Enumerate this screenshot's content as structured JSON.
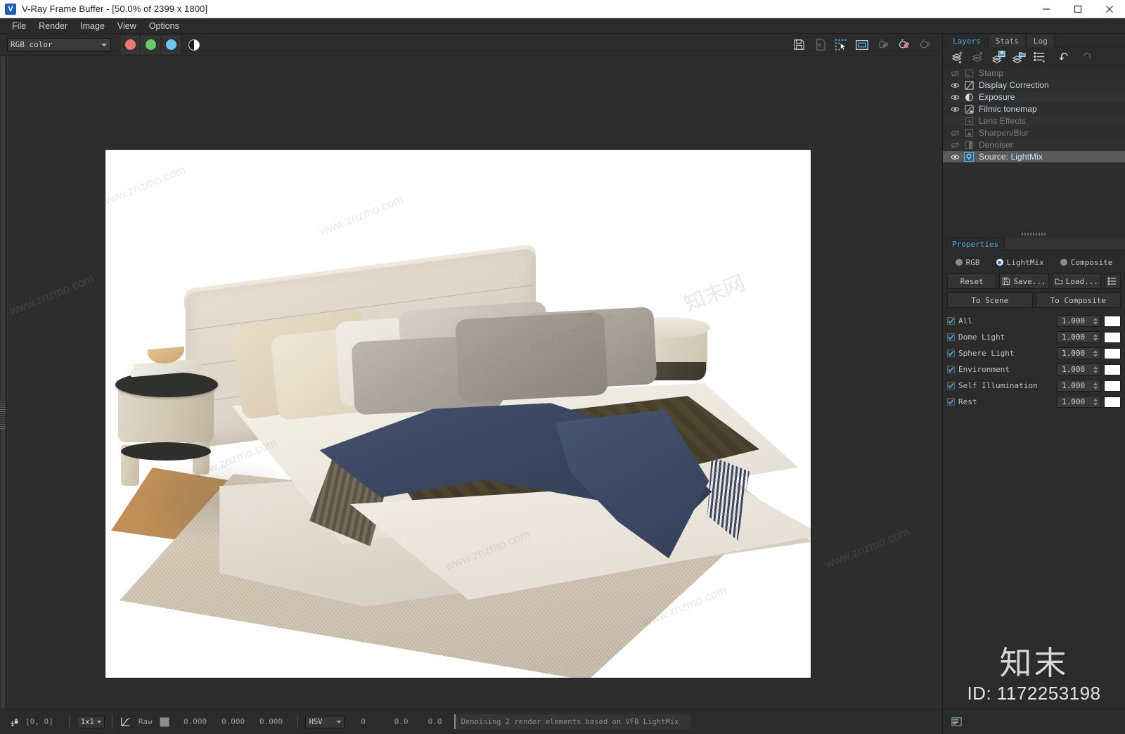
{
  "window": {
    "title": "V-Ray Frame Buffer - [50.0% of 2399 x 1800]",
    "icon": "vray-logo-icon",
    "minimize": "—",
    "maximize": "☐",
    "close": "✕"
  },
  "menubar": {
    "items": [
      {
        "label": "File"
      },
      {
        "label": "Render"
      },
      {
        "label": "Image"
      },
      {
        "label": "View"
      },
      {
        "label": "Options"
      }
    ]
  },
  "toolbar": {
    "channel_select": {
      "value": "RGB color",
      "icon": "chevron-down-icon"
    },
    "channels": [
      {
        "name": "red-channel-button",
        "color": "#eb7b78"
      },
      {
        "name": "green-channel-button",
        "color": "#6bcc6b"
      },
      {
        "name": "blue-channel-button",
        "color": "#6fc8ef"
      }
    ],
    "alpha_button": "alpha-channel-icon",
    "right_icons": [
      "save-image-icon",
      "save-all-channels-icon",
      "region-render-icon",
      "show-vfb-icon",
      "render-last-icon",
      "render-icon",
      "render-stop-icon"
    ]
  },
  "image": {
    "zoom_label": "50.0%",
    "resolution": "2399 x 1800",
    "scene_description": "Interior render of an upholstered platform bed with pillows, a grey-green checked runner, a navy blue throw, two round nightstands and a beige area rug on a white background",
    "watermarks": [
      "www.znzmo.com",
      "www.znzmo.com",
      "www.znzmo.com",
      "www.znzmo.com",
      "www.znzmo.com",
      "www.znzmo.com",
      "知末网"
    ]
  },
  "statusbar": {
    "pin_icon": "pixel-lock-icon",
    "coords": "[0,  0]",
    "sample_size": "1x1",
    "curve_icon": "color-curve-icon",
    "raw_label": "Raw",
    "color_swatch": "#8d8d8d",
    "values": [
      "0.000",
      "0.000",
      "0.000"
    ],
    "color_mode": "HSV",
    "hsv": [
      "0",
      "0.0",
      "0.0"
    ],
    "message": "Denoising 2 render elements based on VFB LightMix",
    "layout_icon": "panel-layout-icon"
  },
  "right_panel": {
    "tabs": [
      {
        "label": "Layers",
        "active": true
      },
      {
        "label": "Stats",
        "active": false
      },
      {
        "label": "Log",
        "active": false
      }
    ],
    "layer_toolbar_icons": [
      "add-layer-icon",
      "delete-layer-icon",
      "save-layer-icon",
      "load-layer-icon",
      "layer-list-icon",
      "undo-icon",
      "redo-icon"
    ],
    "layers": [
      {
        "label": "Stamp",
        "icon": "stamp-icon",
        "visible": false,
        "enabled": false,
        "selected": false
      },
      {
        "label": "Display Correction",
        "icon": "curve-icon",
        "visible": true,
        "enabled": true,
        "selected": false
      },
      {
        "label": "Exposure",
        "icon": "exposure-icon",
        "visible": true,
        "enabled": true,
        "selected": false
      },
      {
        "label": "Filmic tonemap",
        "icon": "filmic-tonemap-icon",
        "visible": true,
        "enabled": true,
        "selected": false
      },
      {
        "label": "Lens Effects",
        "icon": "lens-effects-icon",
        "visible": false,
        "enabled": false,
        "selected": false
      },
      {
        "label": "Sharpen/Blur",
        "icon": "sharpen-blur-icon",
        "visible": false,
        "enabled": false,
        "selected": false
      },
      {
        "label": "Denoiser",
        "icon": "denoiser-icon",
        "visible": false,
        "enabled": false,
        "selected": false
      },
      {
        "label": "Source: LightMix",
        "icon": "lightmix-icon",
        "visible": true,
        "enabled": true,
        "selected": true
      }
    ],
    "properties": {
      "tab_label": "Properties",
      "modes": [
        {
          "label": "RGB",
          "selected": false
        },
        {
          "label": "LightMix",
          "selected": true
        },
        {
          "label": "Composite",
          "selected": false
        }
      ],
      "buttons": [
        {
          "label": "Reset",
          "icon": null
        },
        {
          "label": "Save...",
          "icon": "floppy-icon"
        },
        {
          "label": "Load...",
          "icon": "folder-icon"
        },
        {
          "label": "",
          "icon": "list-menu-icon"
        }
      ],
      "buttons_row2": [
        {
          "label": "To Scene"
        },
        {
          "label": "To Composite"
        }
      ],
      "lights": [
        {
          "label": "All",
          "checked": true,
          "value": "1.000",
          "color": "#ffffff"
        },
        {
          "label": "Dome Light",
          "checked": true,
          "value": "1.000",
          "color": "#ffffff"
        },
        {
          "label": "Sphere Light",
          "checked": true,
          "value": "1.000",
          "color": "#ffffff"
        },
        {
          "label": "Environment",
          "checked": true,
          "value": "1.000",
          "color": "#ffffff"
        },
        {
          "label": "Self Illumination",
          "checked": true,
          "value": "1.000",
          "color": "#ffffff"
        },
        {
          "label": "Rest",
          "checked": true,
          "value": "1.000",
          "color": "#ffffff"
        }
      ]
    },
    "branding": {
      "logo_text": "知末",
      "id_text": "ID: 1172253198"
    }
  },
  "colors": {
    "accent": "#4fa7e0",
    "panel_bg": "#2b2b2b",
    "list_bg": "#2e2e2e",
    "selection": "#5a5a5a",
    "text": "#c2c2c2"
  }
}
